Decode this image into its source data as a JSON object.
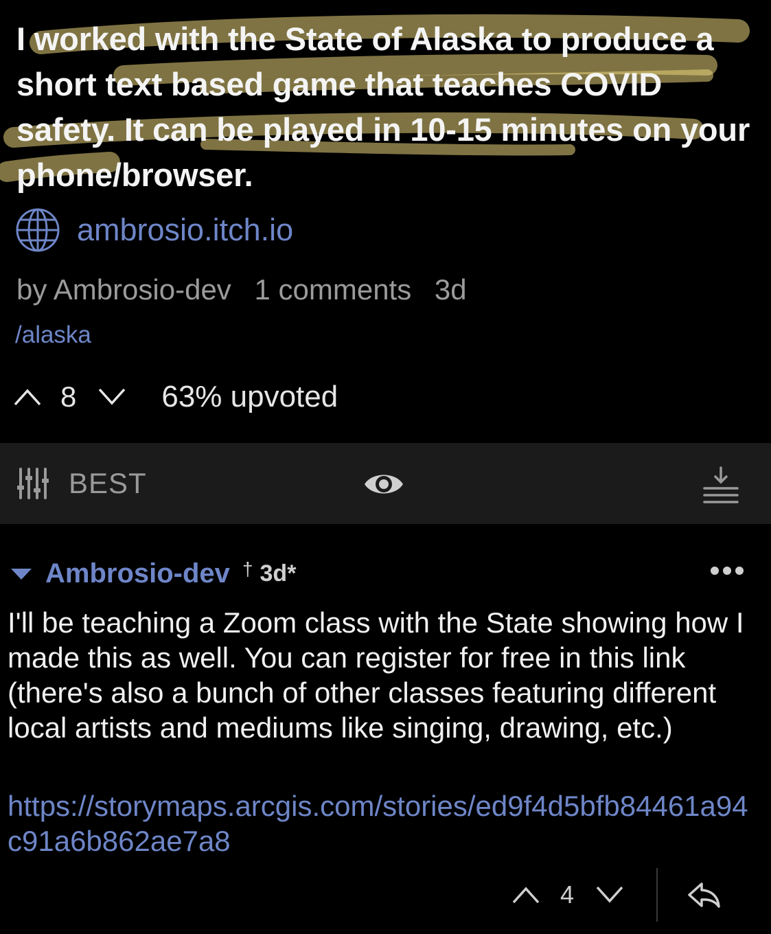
{
  "post": {
    "title": "I worked with the State of Alaska to produce a short text based game that teaches COVID safety. It can be played in 10-15 minutes on your phone/browser.",
    "link_domain": "ambrosio.itch.io",
    "author": "by Ambrosio-dev",
    "comments": "1 comments",
    "age": "3d",
    "subreddit": "/alaska",
    "score": "8",
    "upvote_ratio": "63% upvoted"
  },
  "sort_bar": {
    "sort_label": "BEST",
    "icons": [
      "sliders-icon",
      "eye-icon",
      "collapse-all-icon"
    ]
  },
  "comment": {
    "author": "Ambrosio-dev",
    "marker": "†",
    "age": "3d*",
    "body": "I'll be teaching a Zoom class with the State showing how I made this as well. You can register for free in this link (there's also a bunch of other classes featuring different local artists and mediums like singing, drawing, etc.)",
    "link": "https://storymaps.arcgis.com/stories/ed9f4d5bfb84461a94c91a6b862ae7a8",
    "score": "4"
  },
  "colors": {
    "background": "#000000",
    "sort_bar_background": "#1b1b1b",
    "link_blue": "#6e86c8",
    "meta_gray": "#9b9b9b",
    "highlight_yellow": "#e8d27a"
  }
}
